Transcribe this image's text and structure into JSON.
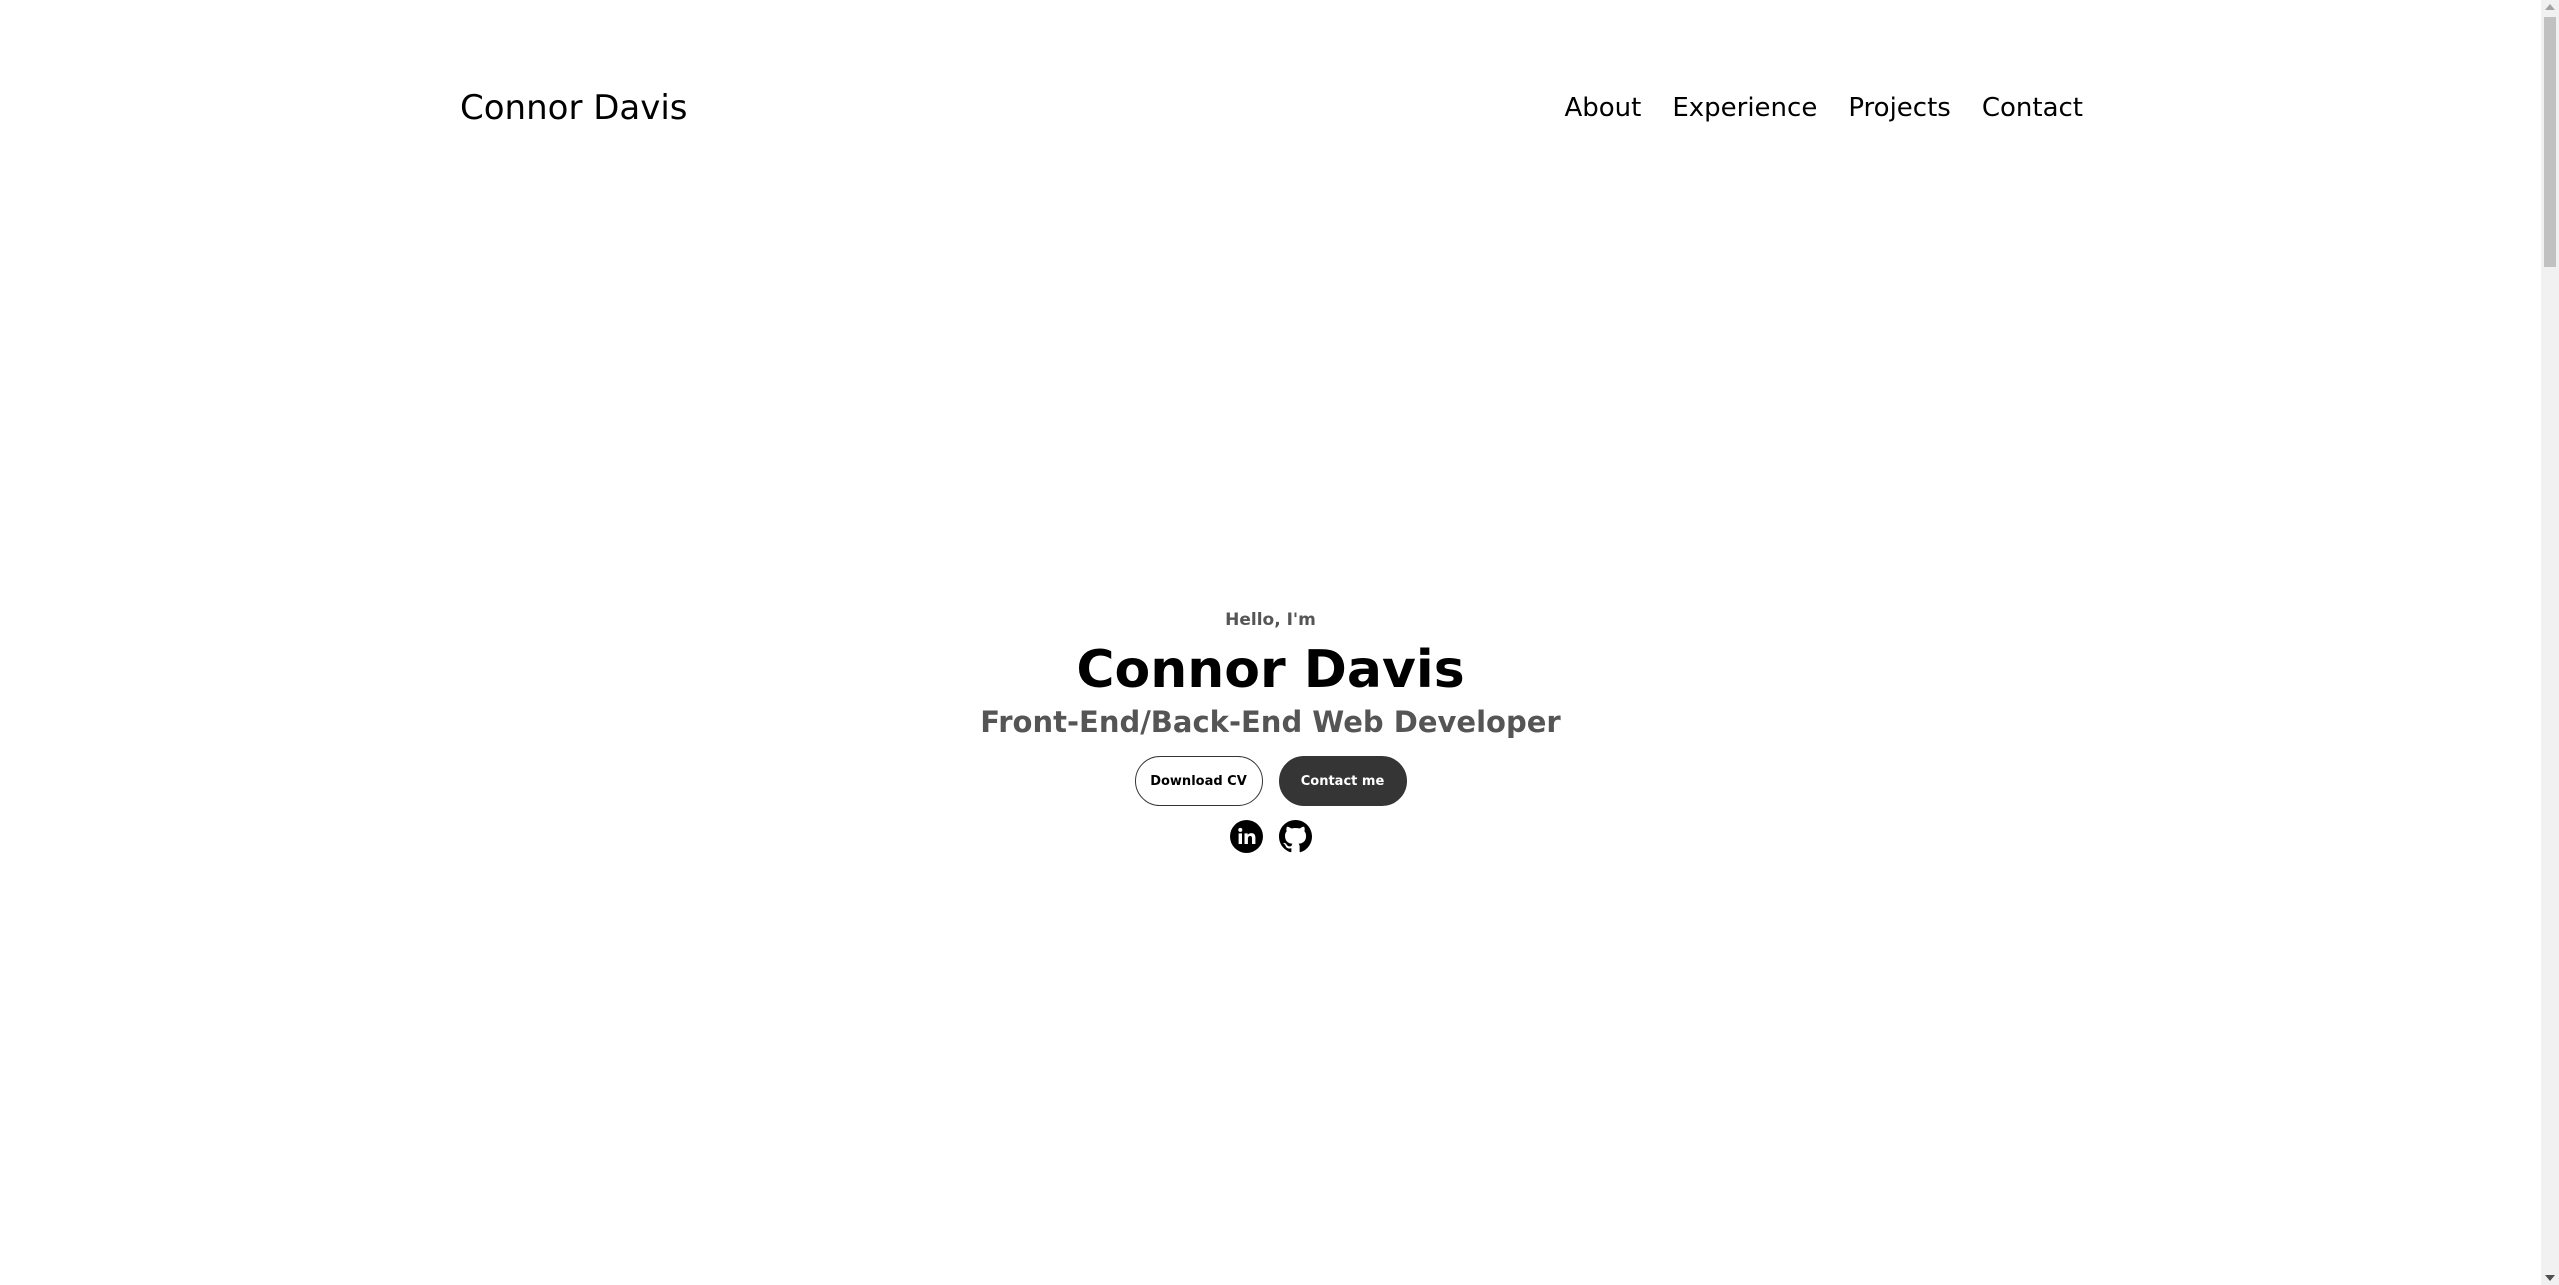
{
  "header": {
    "logo": "Connor Davis",
    "nav": [
      {
        "label": "About"
      },
      {
        "label": "Experience"
      },
      {
        "label": "Projects"
      },
      {
        "label": "Contact"
      }
    ]
  },
  "hero": {
    "greeting": "Hello, I'm",
    "name": "Connor Davis",
    "role": "Front-End/Back-End Web Developer",
    "buttons": {
      "download_cv": "Download CV",
      "contact_me": "Contact me"
    },
    "socials": [
      {
        "icon": "linkedin-icon"
      },
      {
        "icon": "github-icon"
      }
    ]
  },
  "colors": {
    "background": "#ffffff",
    "text": "#000000",
    "muted_text": "#555555",
    "button_dark": "#353535"
  }
}
